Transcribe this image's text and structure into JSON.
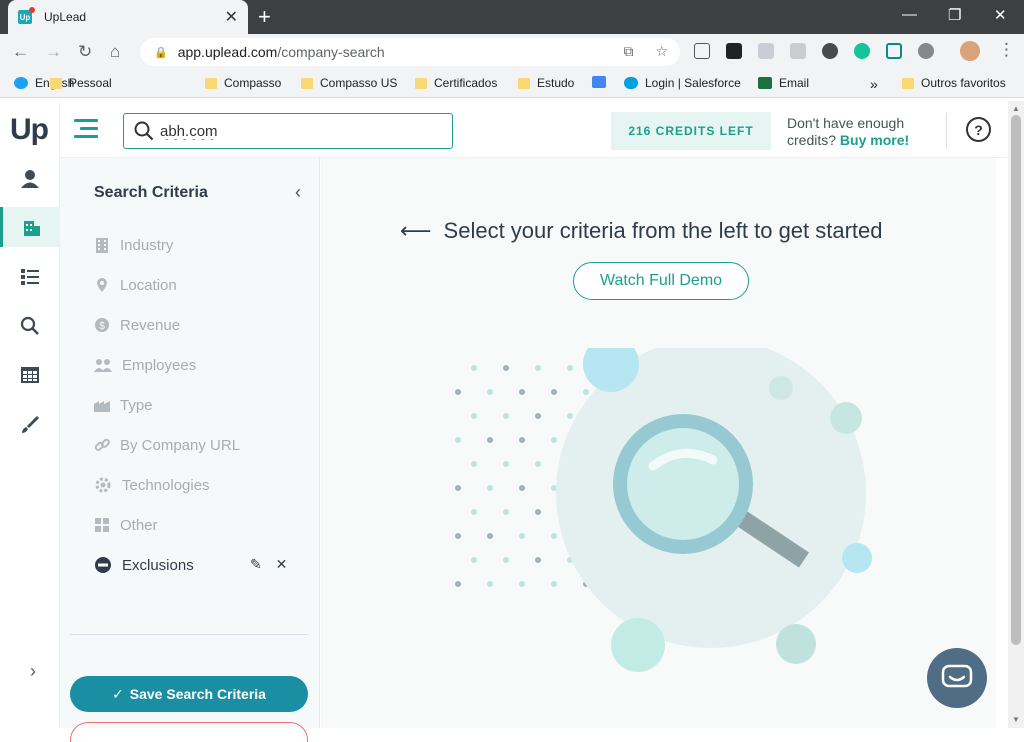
{
  "browser": {
    "tab_title": "UpLead",
    "favicon_text": "Up",
    "url_host": "app.uplead.com",
    "url_path": "/company-search",
    "bookmarks": [
      {
        "label": "English",
        "icon": "twitter-icon"
      },
      {
        "label": "Pessoal",
        "icon": "folder-icon"
      },
      {
        "label": "Compasso",
        "icon": "folder-icon"
      },
      {
        "label": "Compasso US",
        "icon": "folder-icon"
      },
      {
        "label": "Certificados",
        "icon": "folder-icon"
      },
      {
        "label": "Estudo",
        "icon": "folder-icon"
      },
      {
        "label": "Login | Salesforce",
        "icon": "salesforce-icon"
      },
      {
        "label": "Email",
        "icon": "excel-icon"
      }
    ],
    "bookmarks_overflow": "»",
    "other_bookmarks": "Outros favoritos"
  },
  "app": {
    "logo": "Up",
    "search": {
      "value": "abh.com",
      "placeholder": ""
    },
    "credits": "216 CREDITS LEFT",
    "credits_hint_line1": "Don't have enough",
    "credits_hint_line2": "credits?",
    "buy_more": "Buy more",
    "buy_more_suffix": "!",
    "help": "?"
  },
  "criteria": {
    "title": "Search Criteria",
    "items": [
      {
        "label": "Industry",
        "icon": "building-icon"
      },
      {
        "label": "Location",
        "icon": "location-pin-icon"
      },
      {
        "label": "Revenue",
        "icon": "dollar-icon"
      },
      {
        "label": "Employees",
        "icon": "people-icon"
      },
      {
        "label": "Type",
        "icon": "factory-icon"
      },
      {
        "label": "By Company URL",
        "icon": "link-icon"
      },
      {
        "label": "Technologies",
        "icon": "gear-icon"
      },
      {
        "label": "Other",
        "icon": "grid-icon"
      },
      {
        "label": "Exclusions",
        "icon": "minus-circle-icon"
      }
    ],
    "save_label": "Save Search Criteria"
  },
  "main": {
    "prompt": "Select your criteria from the left to get started",
    "demo_label": "Watch Full Demo"
  },
  "colors": {
    "brand": "#1c9f8e",
    "save_button": "#1a8ea3",
    "chrome_dark": "#3c4043"
  }
}
